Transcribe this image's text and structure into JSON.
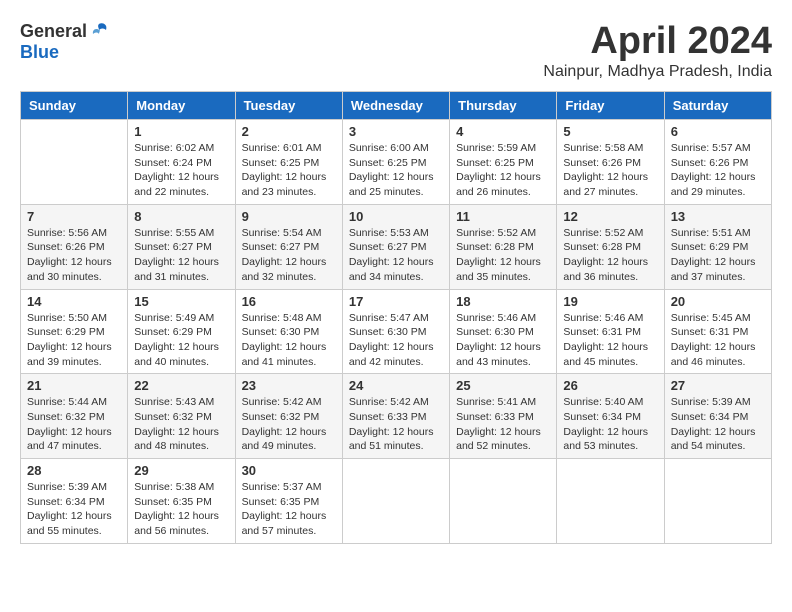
{
  "header": {
    "logo_general": "General",
    "logo_blue": "Blue",
    "month": "April 2024",
    "location": "Nainpur, Madhya Pradesh, India"
  },
  "weekdays": [
    "Sunday",
    "Monday",
    "Tuesday",
    "Wednesday",
    "Thursday",
    "Friday",
    "Saturday"
  ],
  "weeks": [
    [
      {
        "day": "",
        "info": ""
      },
      {
        "day": "1",
        "info": "Sunrise: 6:02 AM\nSunset: 6:24 PM\nDaylight: 12 hours\nand 22 minutes."
      },
      {
        "day": "2",
        "info": "Sunrise: 6:01 AM\nSunset: 6:25 PM\nDaylight: 12 hours\nand 23 minutes."
      },
      {
        "day": "3",
        "info": "Sunrise: 6:00 AM\nSunset: 6:25 PM\nDaylight: 12 hours\nand 25 minutes."
      },
      {
        "day": "4",
        "info": "Sunrise: 5:59 AM\nSunset: 6:25 PM\nDaylight: 12 hours\nand 26 minutes."
      },
      {
        "day": "5",
        "info": "Sunrise: 5:58 AM\nSunset: 6:26 PM\nDaylight: 12 hours\nand 27 minutes."
      },
      {
        "day": "6",
        "info": "Sunrise: 5:57 AM\nSunset: 6:26 PM\nDaylight: 12 hours\nand 29 minutes."
      }
    ],
    [
      {
        "day": "7",
        "info": "Sunrise: 5:56 AM\nSunset: 6:26 PM\nDaylight: 12 hours\nand 30 minutes."
      },
      {
        "day": "8",
        "info": "Sunrise: 5:55 AM\nSunset: 6:27 PM\nDaylight: 12 hours\nand 31 minutes."
      },
      {
        "day": "9",
        "info": "Sunrise: 5:54 AM\nSunset: 6:27 PM\nDaylight: 12 hours\nand 32 minutes."
      },
      {
        "day": "10",
        "info": "Sunrise: 5:53 AM\nSunset: 6:27 PM\nDaylight: 12 hours\nand 34 minutes."
      },
      {
        "day": "11",
        "info": "Sunrise: 5:52 AM\nSunset: 6:28 PM\nDaylight: 12 hours\nand 35 minutes."
      },
      {
        "day": "12",
        "info": "Sunrise: 5:52 AM\nSunset: 6:28 PM\nDaylight: 12 hours\nand 36 minutes."
      },
      {
        "day": "13",
        "info": "Sunrise: 5:51 AM\nSunset: 6:29 PM\nDaylight: 12 hours\nand 37 minutes."
      }
    ],
    [
      {
        "day": "14",
        "info": "Sunrise: 5:50 AM\nSunset: 6:29 PM\nDaylight: 12 hours\nand 39 minutes."
      },
      {
        "day": "15",
        "info": "Sunrise: 5:49 AM\nSunset: 6:29 PM\nDaylight: 12 hours\nand 40 minutes."
      },
      {
        "day": "16",
        "info": "Sunrise: 5:48 AM\nSunset: 6:30 PM\nDaylight: 12 hours\nand 41 minutes."
      },
      {
        "day": "17",
        "info": "Sunrise: 5:47 AM\nSunset: 6:30 PM\nDaylight: 12 hours\nand 42 minutes."
      },
      {
        "day": "18",
        "info": "Sunrise: 5:46 AM\nSunset: 6:30 PM\nDaylight: 12 hours\nand 43 minutes."
      },
      {
        "day": "19",
        "info": "Sunrise: 5:46 AM\nSunset: 6:31 PM\nDaylight: 12 hours\nand 45 minutes."
      },
      {
        "day": "20",
        "info": "Sunrise: 5:45 AM\nSunset: 6:31 PM\nDaylight: 12 hours\nand 46 minutes."
      }
    ],
    [
      {
        "day": "21",
        "info": "Sunrise: 5:44 AM\nSunset: 6:32 PM\nDaylight: 12 hours\nand 47 minutes."
      },
      {
        "day": "22",
        "info": "Sunrise: 5:43 AM\nSunset: 6:32 PM\nDaylight: 12 hours\nand 48 minutes."
      },
      {
        "day": "23",
        "info": "Sunrise: 5:42 AM\nSunset: 6:32 PM\nDaylight: 12 hours\nand 49 minutes."
      },
      {
        "day": "24",
        "info": "Sunrise: 5:42 AM\nSunset: 6:33 PM\nDaylight: 12 hours\nand 51 minutes."
      },
      {
        "day": "25",
        "info": "Sunrise: 5:41 AM\nSunset: 6:33 PM\nDaylight: 12 hours\nand 52 minutes."
      },
      {
        "day": "26",
        "info": "Sunrise: 5:40 AM\nSunset: 6:34 PM\nDaylight: 12 hours\nand 53 minutes."
      },
      {
        "day": "27",
        "info": "Sunrise: 5:39 AM\nSunset: 6:34 PM\nDaylight: 12 hours\nand 54 minutes."
      }
    ],
    [
      {
        "day": "28",
        "info": "Sunrise: 5:39 AM\nSunset: 6:34 PM\nDaylight: 12 hours\nand 55 minutes."
      },
      {
        "day": "29",
        "info": "Sunrise: 5:38 AM\nSunset: 6:35 PM\nDaylight: 12 hours\nand 56 minutes."
      },
      {
        "day": "30",
        "info": "Sunrise: 5:37 AM\nSunset: 6:35 PM\nDaylight: 12 hours\nand 57 minutes."
      },
      {
        "day": "",
        "info": ""
      },
      {
        "day": "",
        "info": ""
      },
      {
        "day": "",
        "info": ""
      },
      {
        "day": "",
        "info": ""
      }
    ]
  ]
}
